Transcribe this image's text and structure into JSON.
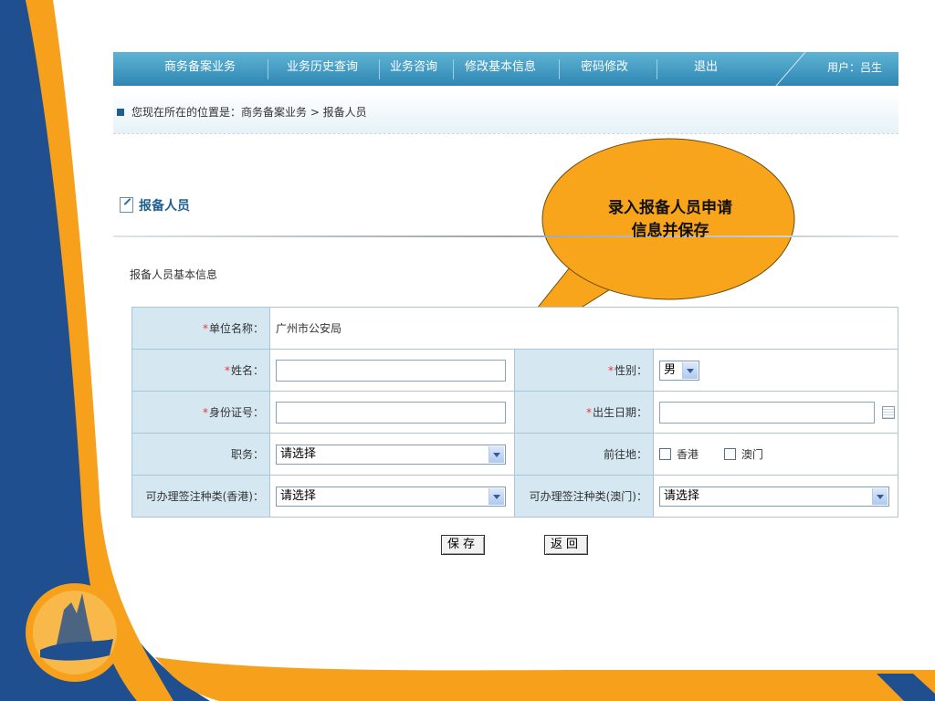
{
  "nav": {
    "items": [
      "商务备案业务",
      "业务历史查询",
      "业务咨询",
      "修改基本信息",
      "密码修改",
      "退出"
    ],
    "user": "用户：吕生"
  },
  "breadcrumb": {
    "text": "您现在所在的位置是：商务备案业务 > 报备人员"
  },
  "section_title": "报备人员",
  "subsection_title": "报备人员基本信息",
  "form": {
    "unit_label": "单位名称：",
    "unit_value": "广州市公安局",
    "name_label": "姓名：",
    "name_value": "",
    "gender_label": "性别：",
    "gender_value": "男",
    "id_label": "身份证号：",
    "id_value": "",
    "birth_label": "出生日期：",
    "birth_value": "",
    "position_label": "职务：",
    "position_value": "请选择",
    "destination_label": "前往地：",
    "hk_option": "香港",
    "macau_option": "澳门",
    "hk_visa_label": "可办理签注种类(香港)：",
    "hk_visa_value": "请选择",
    "macau_visa_label": "可办理签注种类(澳门)：",
    "macau_visa_value": "请选择",
    "required_mark": "*"
  },
  "buttons": {
    "save": "保存",
    "back": "返回"
  },
  "callout": {
    "line1": "录入报备人员申请",
    "line2": "信息并保存"
  },
  "colors": {
    "nav_bg": "#3a8fbb",
    "label_bg": "#d5e7f1",
    "accent_orange": "#f7a01c",
    "accent_blue": "#1f4f8f",
    "title_blue": "#1f5f8f"
  }
}
